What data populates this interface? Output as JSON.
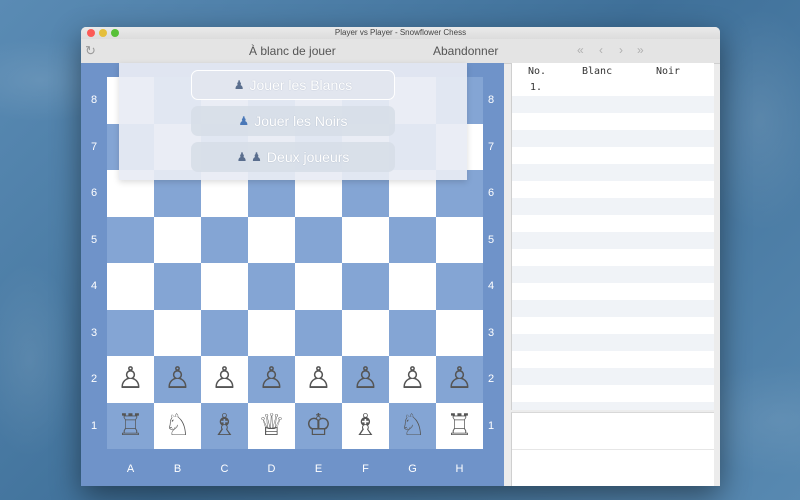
{
  "window": {
    "title": "Player vs Player - Snowflower Chess"
  },
  "toolbar": {
    "refresh_icon": "↻",
    "status": "À blanc de jouer",
    "resign_label": "Abandonner",
    "nav_first": "«",
    "nav_prev": "‹",
    "nav_next": "›",
    "nav_last": "»"
  },
  "mode_menu": {
    "white_label": "Jouer les Blancs",
    "black_label": "Jouer les Noirs",
    "two_label": "Deux joueurs",
    "white_icon": "♟",
    "black_icon": "♟",
    "two_icon": "♟ ♟"
  },
  "board": {
    "ranks": [
      "8",
      "7",
      "6",
      "5",
      "4",
      "3",
      "2",
      "1"
    ],
    "files": [
      "A",
      "B",
      "C",
      "D",
      "E",
      "F",
      "G",
      "H"
    ],
    "rows": [
      [
        "",
        "",
        "",
        "",
        "",
        "",
        "",
        ""
      ],
      [
        "",
        "",
        "",
        "",
        "",
        "",
        "",
        ""
      ],
      [
        "",
        "",
        "",
        "",
        "",
        "",
        "",
        ""
      ],
      [
        "",
        "",
        "",
        "",
        "",
        "",
        "",
        ""
      ],
      [
        "",
        "",
        "",
        "",
        "",
        "",
        "",
        ""
      ],
      [
        "",
        "",
        "",
        "",
        "",
        "",
        "",
        ""
      ],
      [
        "♙",
        "♙",
        "♙",
        "♙",
        "♙",
        "♙",
        "♙",
        "♙"
      ],
      [
        "♖",
        "♘",
        "♗",
        "♕",
        "♔",
        "♗",
        "♘",
        "♖"
      ]
    ]
  },
  "moves_table": {
    "headers": {
      "no": "No.",
      "white": "Blanc",
      "black": "Noir"
    },
    "rows": [
      {
        "no": "1.",
        "white": "",
        "black": ""
      }
    ]
  }
}
